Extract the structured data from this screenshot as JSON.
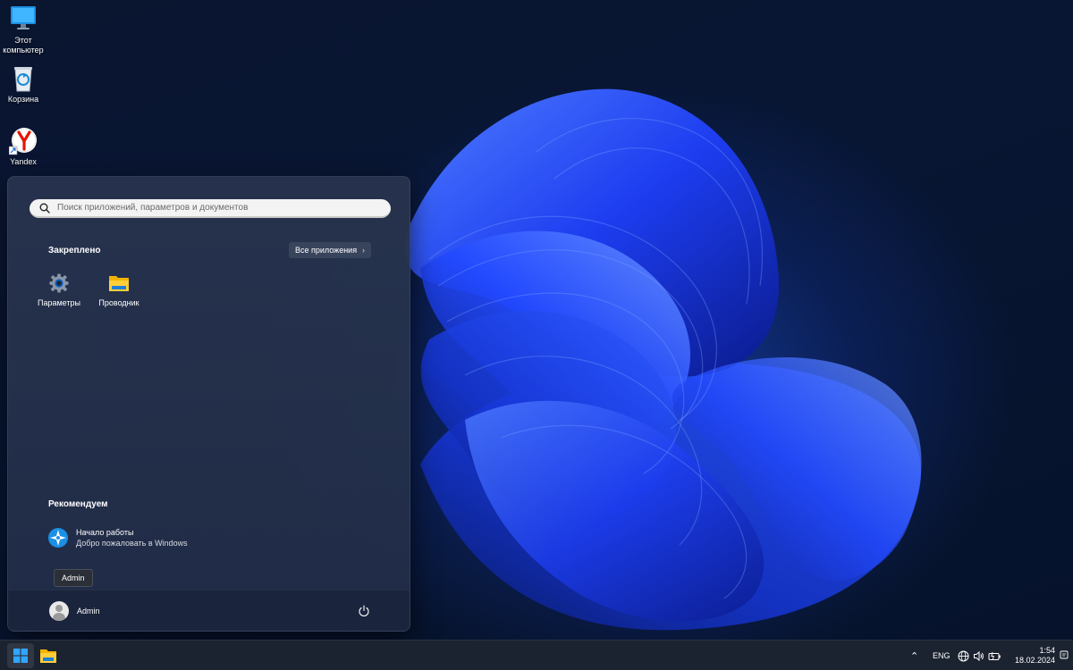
{
  "desktop": {
    "icons": [
      {
        "label": "Этот компьютер",
        "icon": "monitor-icon"
      },
      {
        "label": "Корзина",
        "icon": "recycle-bin-icon"
      },
      {
        "label": "Yandex",
        "icon": "yandex-browser-icon"
      }
    ]
  },
  "start_menu": {
    "search_placeholder": "Поиск приложений, параметров и документов",
    "pinned_title": "Закреплено",
    "all_apps_label": "Все приложения",
    "pinned_apps": [
      {
        "label": "Параметры",
        "icon": "settings-gear-icon"
      },
      {
        "label": "Проводник",
        "icon": "file-explorer-folder-icon"
      }
    ],
    "recommended_title": "Рекомендуем",
    "recommended": [
      {
        "title": "Начало работы",
        "subtitle": "Добро пожаловать в Windows",
        "icon": "get-started-icon"
      }
    ],
    "tooltip": "Admin",
    "user_name": "Admin",
    "power_icon": "power-icon"
  },
  "taskbar": {
    "items": [
      {
        "name": "start",
        "icon": "windows-logo-icon",
        "active": true
      },
      {
        "name": "file-explorer",
        "icon": "folder-icon",
        "active": false
      }
    ],
    "tray": {
      "chevron_icon": "chevron-up-icon",
      "language": "ENG",
      "icons": [
        "globe-network-icon",
        "speaker-icon",
        "battery-icon"
      ]
    },
    "time": "1:54",
    "date": "18.02.2024"
  },
  "colors": {
    "accent": "#0f6cbd",
    "wallpaper_bloom": "#1f3fe0",
    "taskbar_bg": "#1c2330",
    "start_menu_bg": "#28344e"
  }
}
